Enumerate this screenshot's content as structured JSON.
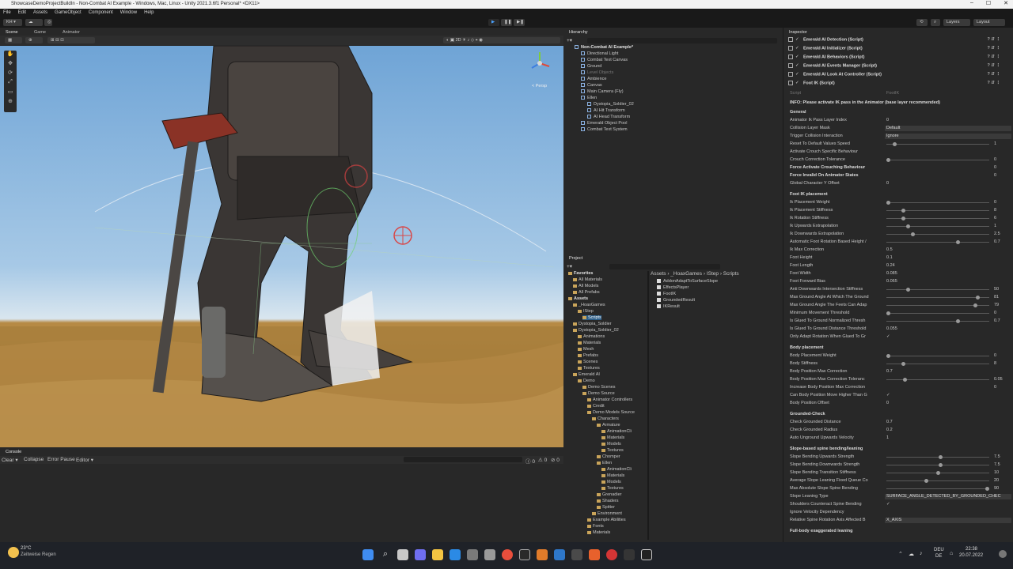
{
  "window": {
    "title": "ShowcaseDemoProjectBuildIn - Non-Combat AI Example - Windows, Mac, Linux - Unity 2021.3.6f1 Personal* <DX11>",
    "controls": [
      "–",
      "☐",
      "✕"
    ]
  },
  "menu": [
    "File",
    "Edit",
    "Assets",
    "GameObject",
    "Component",
    "Window",
    "Help"
  ],
  "toolbar": {
    "account": "KH ▾",
    "layers": "Layers",
    "layout": "Layout"
  },
  "scene_tabs": [
    "Scene",
    "Game",
    "Animator"
  ],
  "scene": {
    "persp": "< Persp",
    "gizmo_axes": [
      "y",
      "x",
      "z"
    ]
  },
  "console": {
    "tab": "Console",
    "buttons": [
      "Clear ▾",
      "Collapse",
      "Error Pause",
      "Editor ▾"
    ],
    "counts": [
      "0",
      "0",
      "0"
    ]
  },
  "hierarchy": {
    "title": "Hierarchy",
    "items": [
      {
        "label": "Non-Combat AI Example*",
        "depth": 0,
        "bold": true
      },
      {
        "label": "Directional Light",
        "depth": 1
      },
      {
        "label": "Combat Text Canvas",
        "depth": 1
      },
      {
        "label": "Ground",
        "depth": 1
      },
      {
        "label": "Level Objects",
        "depth": 1,
        "dim": true
      },
      {
        "label": "Ambience",
        "depth": 1
      },
      {
        "label": "Canvas",
        "depth": 1
      },
      {
        "label": "Main Camera (Fly)",
        "depth": 1
      },
      {
        "label": "Ellen",
        "depth": 1
      },
      {
        "label": "Dystopia_Soldier_02",
        "depth": 2
      },
      {
        "label": "AI Hit Transform",
        "depth": 2
      },
      {
        "label": "AI Head Transform",
        "depth": 2
      },
      {
        "label": "Emerald Object Pool",
        "depth": 1
      },
      {
        "label": "Combat Text System",
        "depth": 1
      }
    ]
  },
  "project": {
    "title": "Project",
    "breadcrumb": [
      "Assets",
      "_HoaxGames",
      "IStep",
      "Scripts"
    ],
    "tree": [
      {
        "label": "Favorites",
        "depth": 0,
        "bold": true
      },
      {
        "label": "All Materials",
        "depth": 1
      },
      {
        "label": "All Models",
        "depth": 1
      },
      {
        "label": "All Prefabs",
        "depth": 1
      },
      {
        "label": "Assets",
        "depth": 0,
        "bold": true
      },
      {
        "label": "_HoaxGames",
        "depth": 1
      },
      {
        "label": "IStep",
        "depth": 2
      },
      {
        "label": "Scripts",
        "depth": 3,
        "selected": true
      },
      {
        "label": "Dystopia_Soldier",
        "depth": 1
      },
      {
        "label": "Dystopia_Soldier_02",
        "depth": 1
      },
      {
        "label": "Animations",
        "depth": 2
      },
      {
        "label": "Materials",
        "depth": 2
      },
      {
        "label": "Mesh",
        "depth": 2
      },
      {
        "label": "Prefabs",
        "depth": 2
      },
      {
        "label": "Scenes",
        "depth": 2
      },
      {
        "label": "Textures",
        "depth": 2
      },
      {
        "label": "Emerald AI",
        "depth": 1
      },
      {
        "label": "Demo",
        "depth": 2
      },
      {
        "label": "Demo Scenes",
        "depth": 3
      },
      {
        "label": "Demo Source",
        "depth": 3
      },
      {
        "label": "Animator Controllers",
        "depth": 4
      },
      {
        "label": "Credit",
        "depth": 4
      },
      {
        "label": "Demo Models Source",
        "depth": 4
      },
      {
        "label": "Characters",
        "depth": 5
      },
      {
        "label": "Armature",
        "depth": 6
      },
      {
        "label": "AnimationCli",
        "depth": 7
      },
      {
        "label": "Materials",
        "depth": 7
      },
      {
        "label": "Models",
        "depth": 7
      },
      {
        "label": "Textures",
        "depth": 7
      },
      {
        "label": "Chomper",
        "depth": 6
      },
      {
        "label": "Ellen",
        "depth": 6
      },
      {
        "label": "AnimationCli",
        "depth": 7
      },
      {
        "label": "Materials",
        "depth": 7
      },
      {
        "label": "Models",
        "depth": 7
      },
      {
        "label": "Textures",
        "depth": 7
      },
      {
        "label": "Grenadier",
        "depth": 6
      },
      {
        "label": "Shaders",
        "depth": 6
      },
      {
        "label": "Spitter",
        "depth": 6
      },
      {
        "label": "Environment",
        "depth": 5
      },
      {
        "label": "Example Abilities",
        "depth": 4
      },
      {
        "label": "Fonts",
        "depth": 4
      },
      {
        "label": "Materials",
        "depth": 4
      }
    ],
    "files": [
      "AddonAdaptToSurfaceSlope",
      "EffectsPlayer",
      "FootIK",
      "GroundedResult",
      "IKResult"
    ]
  },
  "inspector": {
    "title": "Inspector",
    "components": [
      "Emerald AI Detection (Script)",
      "Emerald AI Initializer (Script)",
      "Emerald AI Behaviors (Script)",
      "Emerald AI Events Manager (Script)",
      "Emerald AI Look At Controller (Script)",
      "Foot IK (Script)"
    ],
    "script_label": "Script",
    "script_value": "FootIK",
    "info": "INFO: Please activate IK pass in the Animator (base layer recommended)",
    "sections": [
      {
        "header": "General",
        "rows": [
          {
            "label": "Animator Ik Pass Layer Index",
            "kind": "text",
            "value": "0"
          },
          {
            "label": "Collision Layer Mask",
            "kind": "drop",
            "value": "Default"
          },
          {
            "label": "Trigger Collision Interaction",
            "kind": "drop",
            "value": "Ignore"
          },
          {
            "label": "Reset To Default Values Speed",
            "kind": "slider",
            "value": "1",
            "t": 0.06
          },
          {
            "label": "Activate Crouch Specific Behaviour",
            "kind": "text",
            "value": ""
          },
          {
            "label": "Crouch Correction Tolerance",
            "kind": "slider",
            "value": "0",
            "t": 0.0
          },
          {
            "label": "Force Activate Crouching Behaviour",
            "kind": "sval",
            "value": "0",
            "bold": true
          },
          {
            "label": "Force Invalid On Animator States",
            "kind": "sval",
            "value": "0",
            "bold": true
          },
          {
            "label": "Global Character Y Offset",
            "kind": "text",
            "value": "0"
          }
        ]
      },
      {
        "header": "Foot IK placement",
        "rows": [
          {
            "label": "Ik Placement Weight",
            "kind": "slider",
            "value": "0",
            "t": 0.0
          },
          {
            "label": "Ik Placement Stiffness",
            "kind": "slider",
            "value": "8",
            "t": 0.15
          },
          {
            "label": "Ik Rotation Stiffness",
            "kind": "slider",
            "value": "6",
            "t": 0.15
          },
          {
            "label": "Ik Upwards Extrapolation",
            "kind": "slider",
            "value": "1",
            "t": 0.2
          },
          {
            "label": "Ik Downwards Extrapolation",
            "kind": "slider",
            "value": "2.5",
            "t": 0.25
          },
          {
            "label": "Automatic Foot Rotation Based Height /",
            "kind": "slider",
            "value": "0.7",
            "t": 0.7
          },
          {
            "label": "Ik Max Correction",
            "kind": "text",
            "value": "0.5"
          },
          {
            "label": "Foot Height",
            "kind": "text",
            "value": "0.1"
          },
          {
            "label": "Foot Length",
            "kind": "text",
            "value": "0.24"
          },
          {
            "label": "Foot Width",
            "kind": "text",
            "value": "0.085"
          },
          {
            "label": "Foot Forward Bias",
            "kind": "text",
            "value": "0.065"
          },
          {
            "label": "Anti Downwards Intersection Stiffness",
            "kind": "slider",
            "value": "50",
            "t": 0.2
          },
          {
            "label": "Max Ground Angle At Which The Ground",
            "kind": "slider",
            "value": "81",
            "t": 0.9
          },
          {
            "label": "Max Ground Angle The Feets Can Adap",
            "kind": "slider",
            "value": "79",
            "t": 0.88
          },
          {
            "label": "Minimum Movement Threshold",
            "kind": "slider",
            "value": "0",
            "t": 0.0
          },
          {
            "label": "Is Glued To Ground Normalized Thresh",
            "kind": "slider",
            "value": "0.7",
            "t": 0.7
          },
          {
            "label": "Is Glued To Ground Distance Threshold",
            "kind": "text",
            "value": "0.055"
          },
          {
            "label": "Only Adapt Rotation When Glued To Gr",
            "kind": "check",
            "value": "✓"
          }
        ]
      },
      {
        "header": "Body placement",
        "rows": [
          {
            "label": "Body Placement Weight",
            "kind": "slider",
            "value": "0",
            "t": 0.0
          },
          {
            "label": "Body Stiffness",
            "kind": "slider",
            "value": "8",
            "t": 0.15
          },
          {
            "label": "Body Position Max Correction",
            "kind": "text",
            "value": "0.7"
          },
          {
            "label": "Body Position Max Correction Toleranc",
            "kind": "slider",
            "value": "0.05",
            "t": 0.17
          },
          {
            "label": "Increase Body Position Max Correction",
            "kind": "sval",
            "value": "0"
          },
          {
            "label": "Can Body Position Move Higher Than G",
            "kind": "check",
            "value": "✓"
          },
          {
            "label": "Body Position Offset",
            "kind": "text",
            "value": "0"
          }
        ]
      },
      {
        "header": "Grounded-Check",
        "rows": [
          {
            "label": "Check Grounded Distance",
            "kind": "text",
            "value": "0.7"
          },
          {
            "label": "Check Grounded Radius",
            "kind": "text",
            "value": "0.2"
          },
          {
            "label": "Auto Unground Upwards Velocity",
            "kind": "text",
            "value": "1"
          }
        ]
      },
      {
        "header": "Slope-based spine bending/leaning",
        "rows": [
          {
            "label": "Slope Bending Upwards Strength",
            "kind": "slider",
            "value": "7.5",
            "t": 0.53
          },
          {
            "label": "Slope Bending Downwards Strength",
            "kind": "slider",
            "value": "7.5",
            "t": 0.53
          },
          {
            "label": "Slope Bending Transition Stiffness",
            "kind": "slider",
            "value": "10",
            "t": 0.5
          },
          {
            "label": "Average Slope Leaning Fixed Queue Co",
            "kind": "slider",
            "value": "20",
            "t": 0.38
          },
          {
            "label": "Max Absolute Slope Spine Bending",
            "kind": "slider",
            "value": "90",
            "t": 1.0
          },
          {
            "label": "Slope Leaning Type",
            "kind": "drop",
            "value": "SURFACE_ANGLE_DETECTED_BY_GROUNDED_CHEC"
          },
          {
            "label": "Shoulders Counteract Spine Bending",
            "kind": "check",
            "value": "✓"
          },
          {
            "label": "Ignore Velocity Dependency",
            "kind": "text",
            "value": ""
          },
          {
            "label": "Relative Spine Rotation Axis Affected B",
            "kind": "drop",
            "value": "X_AXIS"
          }
        ]
      },
      {
        "header": "Full-body exaggerated leaning",
        "rows": []
      }
    ]
  },
  "taskbar": {
    "weather_temp": "23°C",
    "weather_desc": "Zeitweise Regen",
    "lang": "DEU",
    "lang2": "DE",
    "time": "22:38",
    "date": "20.07.2022"
  }
}
